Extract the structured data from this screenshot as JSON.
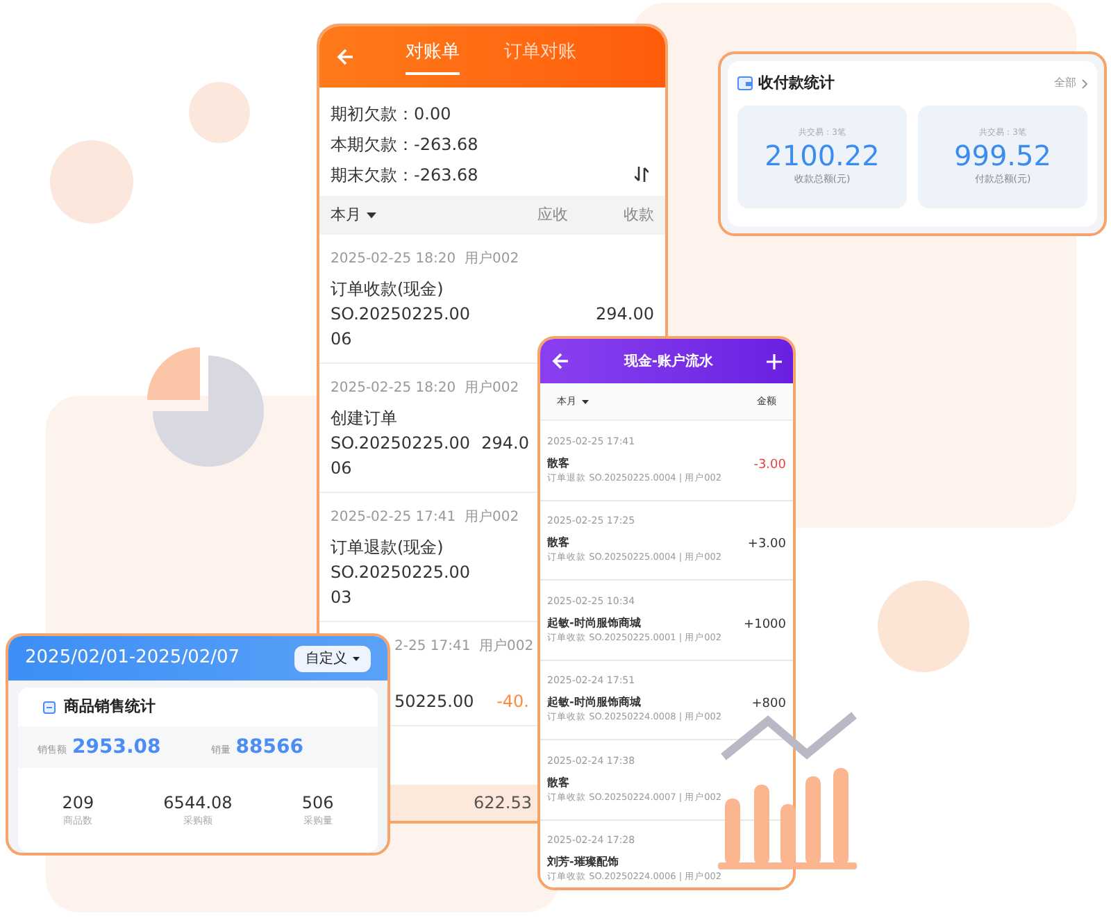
{
  "statement": {
    "tabs": [
      {
        "label": "对账单",
        "selected": true
      },
      {
        "label": "订单对账",
        "selected": false
      }
    ],
    "summary": [
      "期初欠款：0.00",
      "本期欠款：-263.68",
      "期末欠款：-263.68"
    ],
    "columns": {
      "period": "本月",
      "receivable": "应收",
      "received": "收款"
    },
    "entries": [
      {
        "kind": "full",
        "meta": "2025-02-25 18:20  用户002",
        "title": "订单收款(现金)",
        "order": "SO.20250225.00",
        "order_tail": "06",
        "amount": "294.00",
        "negative": false
      },
      {
        "kind": "clipped",
        "meta": "2025-02-25 18:20  用户002",
        "title": "创建订单",
        "order": "SO.20250225.00",
        "order_tail": "06",
        "amount": "294.0",
        "negative": false
      },
      {
        "kind": "full",
        "meta": "2025-02-25 17:41  用户002",
        "title": "订单退款(现金)",
        "order": "SO.20250225.00",
        "order_tail": "03"
      },
      {
        "kind": "offset",
        "meta": "2-25 17:41  用户002",
        "order": "50225.00",
        "amount": "-40.",
        "negative": true
      }
    ],
    "total": "622.53"
  },
  "cashflow": {
    "title": "现金-账户流水",
    "period": "本月",
    "amount_label": "金额",
    "entries": [
      {
        "date": "2025-02-25 17:41",
        "name": "散客",
        "detail": "订单退款 SO.20250225.0004 | 用户002",
        "amount": "-3.00",
        "negative": true
      },
      {
        "date": "2025-02-25 17:25",
        "name": "散客",
        "detail": "订单收款 SO.20250225.0004 | 用户002",
        "amount": "+3.00",
        "negative": false
      },
      {
        "date": "2025-02-25 10:34",
        "name": "起敏-时尚服饰商城",
        "detail": "订单收款 SO.20250225.0001 | 用户002",
        "amount": "+1000",
        "negative": false
      },
      {
        "date": "2025-02-24 17:51",
        "name": "起敏-时尚服饰商城",
        "detail": "订单收款 SO.20250224.0008 | 用户002",
        "amount": "+800",
        "negative": false
      },
      {
        "date": "2025-02-24 17:38",
        "name": "散客",
        "detail": "订单收款 SO.20250224.0007 | 用户002"
      },
      {
        "date": "2025-02-24 17:28",
        "name": "刘芳-璀璨配饰",
        "detail": "订单收款 SO.20250224.0006 | 用户002"
      }
    ]
  },
  "payments": {
    "title": "收付款统计",
    "link": "全部",
    "stats": [
      {
        "caption": "共交易：3笔",
        "value": "2100.22",
        "label": "收款总额(元)"
      },
      {
        "caption": "共交易：3笔",
        "value": "999.52",
        "label": "付款总额(元)"
      }
    ]
  },
  "sales": {
    "range": "2025/02/01-2025/02/07",
    "filter": "自定义",
    "title": "商品销售统计",
    "highlights": [
      {
        "label": "销售额",
        "value": "2953.08"
      },
      {
        "label": "销量",
        "value": "88566"
      }
    ],
    "stats": [
      {
        "value": "209",
        "label": "商品数"
      },
      {
        "value": "6544.08",
        "label": "采购额"
      },
      {
        "value": "506",
        "label": "采购量"
      }
    ]
  }
}
